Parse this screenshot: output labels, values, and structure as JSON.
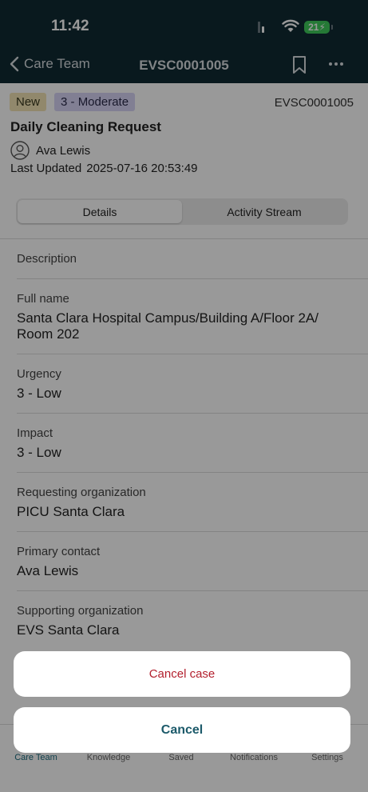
{
  "status_bar": {
    "time": "11:42",
    "battery": "21"
  },
  "nav": {
    "back_label": "Care Team",
    "title": "EVSC0001005"
  },
  "case": {
    "state": "New",
    "priority": "3 - Moderate",
    "number": "EVSC0001005",
    "title": "Daily Cleaning Request",
    "assignee": "Ava Lewis",
    "updated_label": "Last Updated",
    "updated_value": "2025-07-16 20:53:49"
  },
  "segments": [
    "Details",
    "Activity Stream"
  ],
  "fields": [
    {
      "label": "Description",
      "value": ""
    },
    {
      "label": "Full name",
      "value": "Santa Clara Hospital Campus/Building A/Floor 2A/ Room 202"
    },
    {
      "label": "Urgency",
      "value": "3 - Low"
    },
    {
      "label": "Impact",
      "value": "3 - Low"
    },
    {
      "label": "Requesting organization",
      "value": "PICU Santa Clara"
    },
    {
      "label": "Primary contact",
      "value": "Ava Lewis"
    },
    {
      "label": "Supporting organization",
      "value": "EVS Santa Clara"
    }
  ],
  "tabbar": [
    "Care Team",
    "Knowledge",
    "Saved",
    "Notifications",
    "Settings"
  ],
  "action_sheet": {
    "destructive": "Cancel case",
    "cancel": "Cancel"
  }
}
